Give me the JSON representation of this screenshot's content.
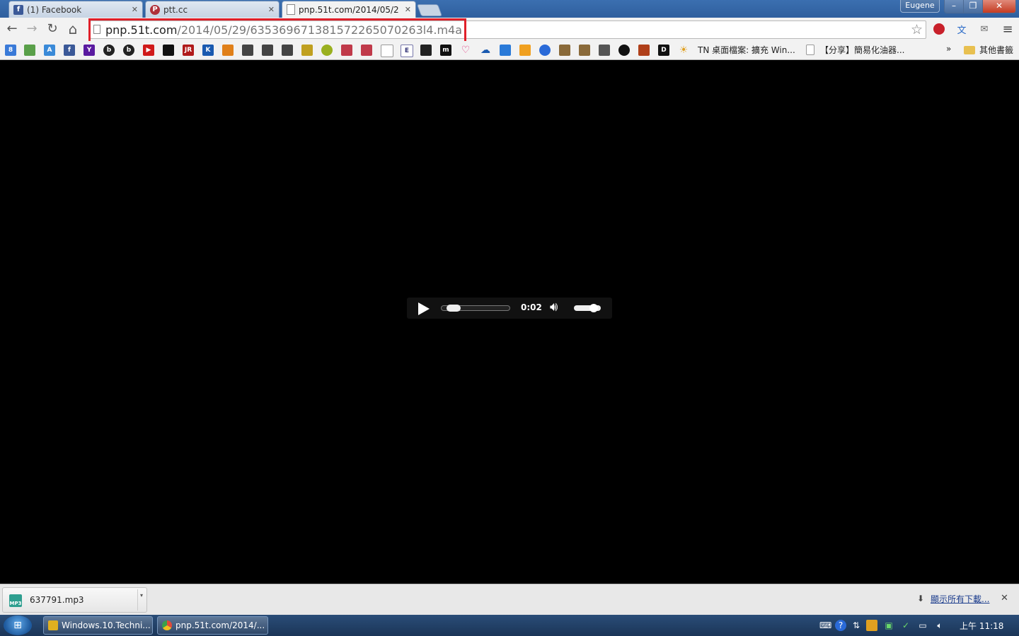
{
  "tabs": [
    {
      "title": "(1) Facebook",
      "icon": "facebook-icon",
      "color": "#3b5998",
      "glyph": "f"
    },
    {
      "title": "ptt.cc",
      "icon": "ptt-icon",
      "color": "#b0303a",
      "glyph": "P"
    },
    {
      "title": "pnp.51t.com/2014/05/2",
      "icon": "page-icon",
      "active": true
    }
  ],
  "window": {
    "profile_name": "Eugene",
    "minimize": "–",
    "maximize": "❐",
    "close": "✕"
  },
  "toolbar": {
    "back": "←",
    "forward": "→",
    "reload": "↻",
    "home": "⌂",
    "star": "☆",
    "menu": "≡",
    "url_host": "pnp.51t.com",
    "url_path": "/2014/05/29/635369671381572265070263l4.m4a"
  },
  "bookmarks": {
    "item1": "TN 桌面檔案: 擴充 Win...",
    "item2": "【分享】簡易化油器...",
    "overflow": "»",
    "other": "其他書籤"
  },
  "player": {
    "time": "0:02",
    "progress": 0.1,
    "volume": 0.85
  },
  "downloads": {
    "file_name": "637791.mp3",
    "file_type": "MP3",
    "show_all": "顯示所有下載...",
    "close": "✕"
  },
  "taskbar": {
    "windows": [
      {
        "title": "Windows.10.Techni...",
        "icon_color": "#e0b020"
      },
      {
        "title": "pnp.51t.com/2014/...",
        "icon_color": "#e04a3a"
      }
    ],
    "clock": "上午 11:18"
  },
  "colors": {
    "highlight": "#e0202a",
    "tab_bar": "#3b6fb0",
    "taskbar": "#1b3557"
  }
}
